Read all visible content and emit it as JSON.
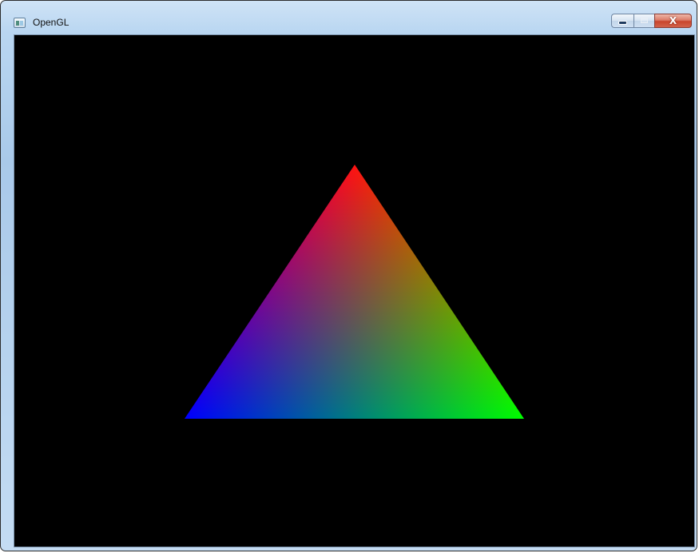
{
  "window": {
    "title": "OpenGL",
    "icon": "application-window-icon",
    "controls": {
      "minimize_icon": "minimize-icon",
      "maximize_icon": "maximize-icon",
      "close_icon": "close-icon",
      "close_glyph": "X"
    }
  },
  "scene": {
    "background_color": "#000000",
    "shape": "triangle",
    "vertex_colors": {
      "top": "#ff0000",
      "bottom_left": "#0000ff",
      "bottom_right": "#00ff00"
    }
  }
}
